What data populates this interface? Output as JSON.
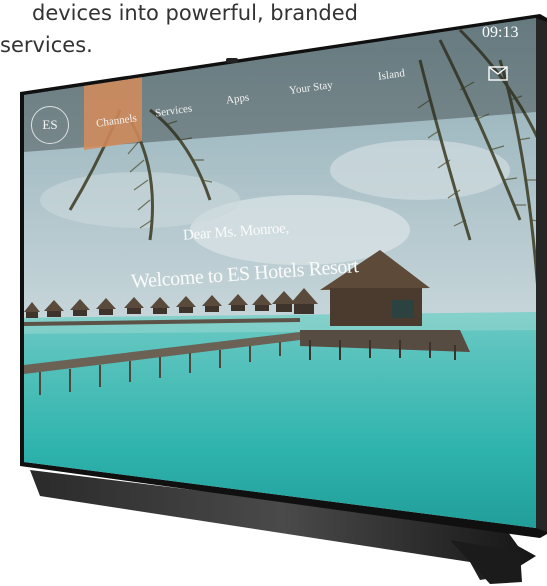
{
  "caption": {
    "line1": "devices into powerful, branded",
    "line2": "services."
  },
  "tv_ui": {
    "logo_text": "ES",
    "nav": [
      {
        "label": "Channels",
        "active": true
      },
      {
        "label": "Services",
        "active": false
      },
      {
        "label": "Apps",
        "active": false
      },
      {
        "label": "Your Stay",
        "active": false
      },
      {
        "label": "Island",
        "active": false
      }
    ],
    "time": "09:13",
    "mail_icon": "mail-icon",
    "greeting": "Dear Ms. Monroe,",
    "welcome": "Welcome to ES Hotels Resort"
  },
  "colors": {
    "accent_active_tab": "#d68c5a",
    "sea": "#2fb3ad",
    "sky": "#b9cdd3"
  }
}
